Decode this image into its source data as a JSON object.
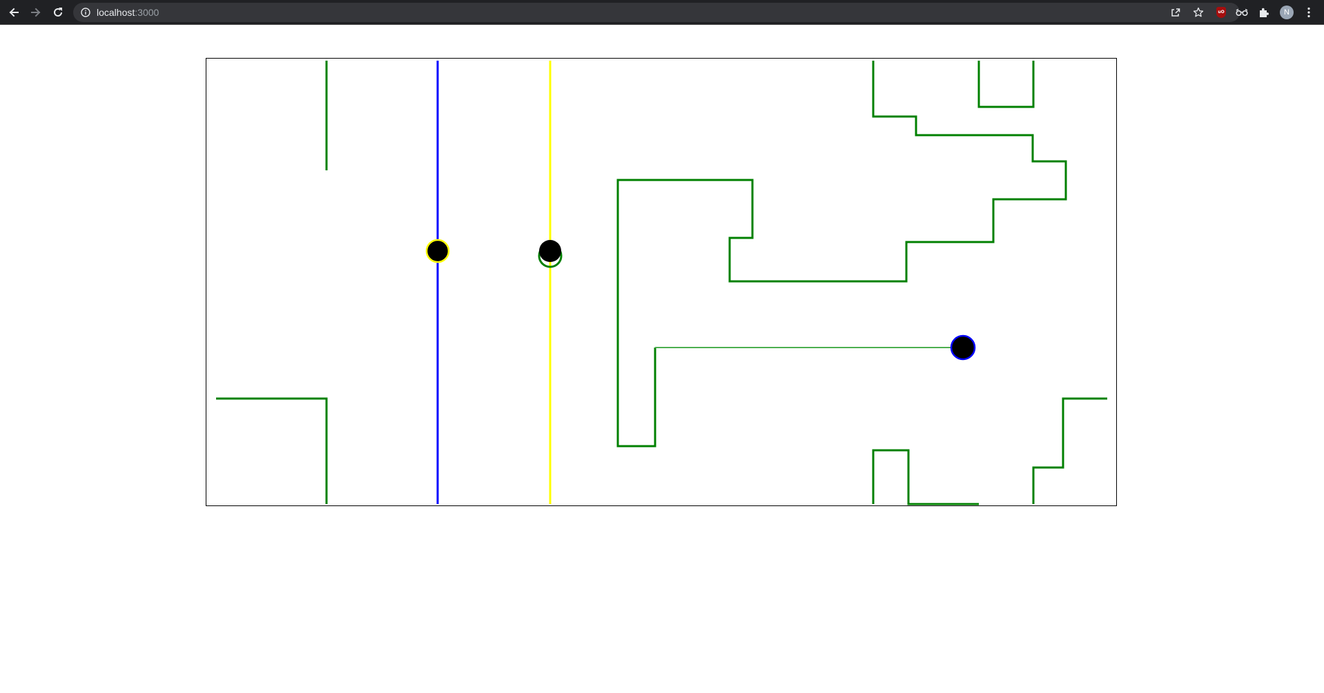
{
  "browser": {
    "url_host": "localhost",
    "url_port": ":3000",
    "profile_initial": "N",
    "extensions": [
      "ublock-origin-icon",
      "glasses-extension-icon",
      "puzzle-extensions-icon"
    ],
    "colors": {
      "toolbar": "#202124",
      "omnibox": "#35363a",
      "icon": "#e8eaed"
    }
  },
  "game": {
    "colors": {
      "wall": "#008000",
      "blue_line": "#0000ff",
      "yellow_line": "#ffff00",
      "player": "#000000",
      "border": "#000000",
      "background": "#ffffff"
    },
    "players": [
      {
        "name": "player-yellow-ring",
        "ring_color": "#ffff00"
      },
      {
        "name": "player-green-ring",
        "ring_color": "#008000"
      },
      {
        "name": "player-blue-ring",
        "ring_color": "#0000ff"
      }
    ]
  }
}
